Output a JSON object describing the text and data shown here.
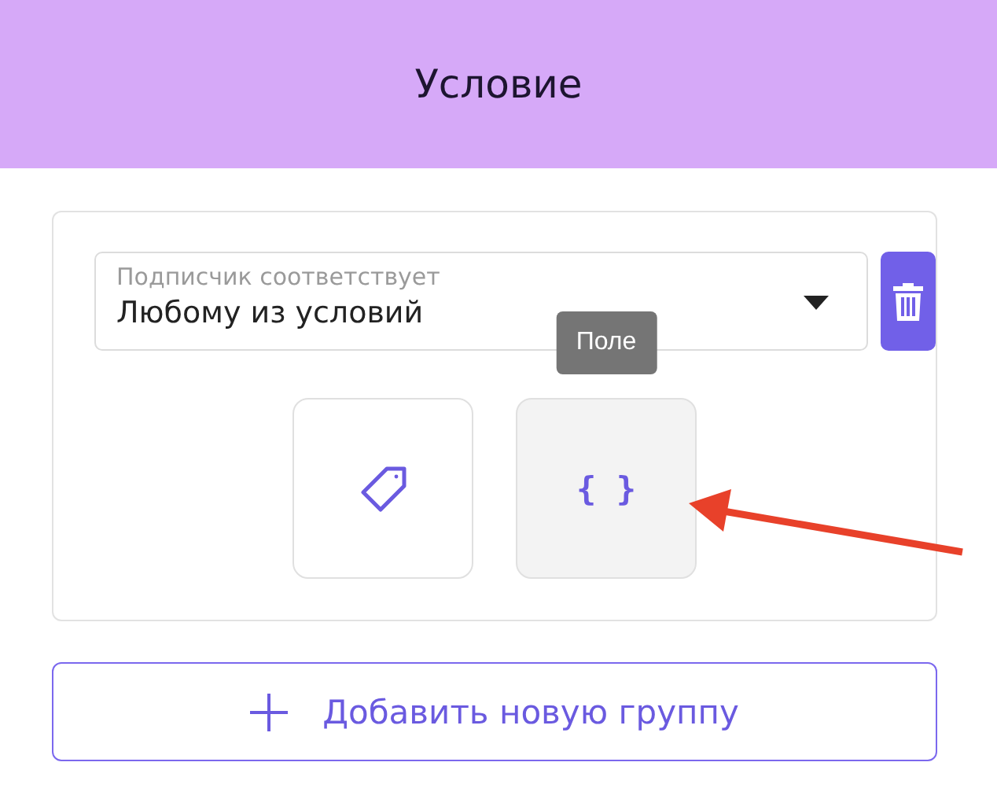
{
  "header": {
    "title": "Условие"
  },
  "condition_group": {
    "select": {
      "label": "Подписчик соответствует",
      "value": "Любому из условий"
    },
    "options": [
      {
        "kind": "tag",
        "hovered": false
      },
      {
        "kind": "field",
        "icon_text": "{ }",
        "hovered": true,
        "tooltip": "Поле"
      }
    ]
  },
  "add_group_button": {
    "label": "Добавить новую группу"
  }
}
